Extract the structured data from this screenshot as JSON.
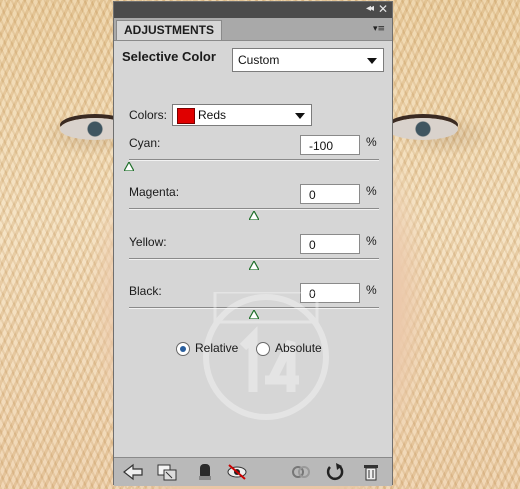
{
  "panel": {
    "tab_title": "ADJUSTMENTS",
    "adjustment_name": "Selective Color",
    "preset": "Custom",
    "colors_label": "Colors:",
    "colors_value": "Reds",
    "colors_swatch": "#e00000",
    "percent_sign": "%",
    "sliders": [
      {
        "label": "Cyan:",
        "value": "-100",
        "level": -100
      },
      {
        "label": "Magenta:",
        "value": "0",
        "level": 0
      },
      {
        "label": "Yellow:",
        "value": "0",
        "level": 0
      },
      {
        "label": "Black:",
        "value": "0",
        "level": 0
      }
    ],
    "methods": {
      "relative": "Relative",
      "absolute": "Absolute",
      "selected": "relative"
    }
  },
  "icons": {
    "header": [
      "collapse-icon",
      "close-icon",
      "panel-menu-icon"
    ],
    "footer": [
      "back-arrow-icon",
      "expanded-view-icon",
      "clip-to-layer-icon",
      "visibility-eye-icon",
      "previous-state-icon",
      "reset-icon",
      "trash-icon"
    ]
  }
}
